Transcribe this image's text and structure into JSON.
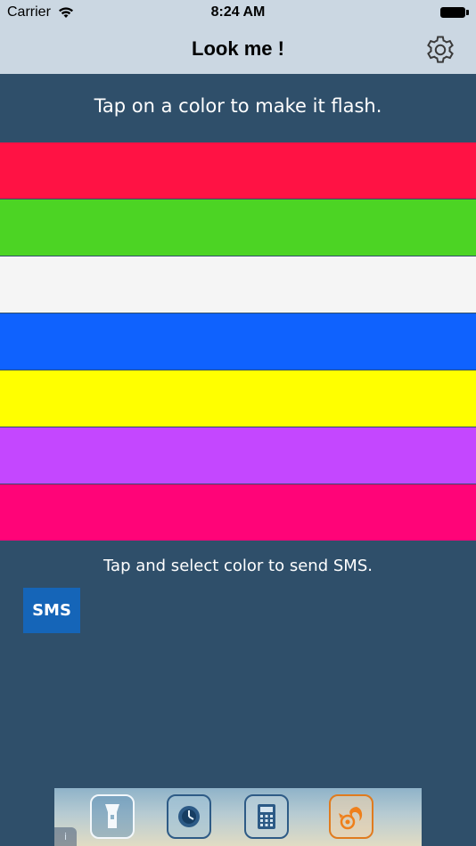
{
  "status_bar": {
    "carrier": "Carrier",
    "time": "8:24 AM"
  },
  "nav": {
    "title": "Look me !"
  },
  "main": {
    "instruction": "Tap on a color to make it flash.",
    "colors": [
      {
        "name": "red",
        "hex": "#ff1244"
      },
      {
        "name": "green",
        "hex": "#4cd424"
      },
      {
        "name": "white",
        "hex": "#f5f5f5"
      },
      {
        "name": "blue",
        "hex": "#0f62fe"
      },
      {
        "name": "yellow",
        "hex": "#ffff00"
      },
      {
        "name": "purple",
        "hex": "#c447ff"
      },
      {
        "name": "pink",
        "hex": "#ff0478"
      }
    ],
    "sms_instruction": "Tap and select color to send SMS.",
    "sms_label": "SMS"
  },
  "ad": {
    "info": "i",
    "tiles": [
      {
        "icon": "flashlight-icon"
      },
      {
        "icon": "timer-icon"
      },
      {
        "icon": "calculator-icon"
      },
      {
        "icon": "squirrel-browser-icon"
      }
    ]
  }
}
